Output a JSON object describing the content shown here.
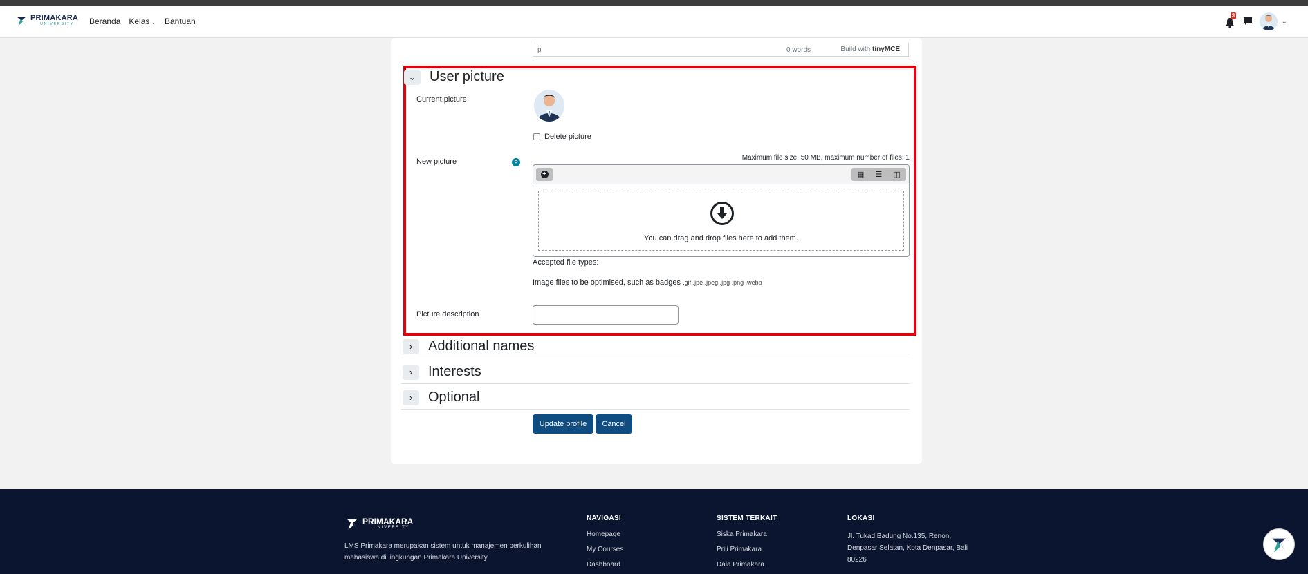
{
  "topbar": {
    "brand_name": "PRIMAKARA",
    "brand_sub": "UNIVERSITY",
    "nav": [
      "Beranda",
      "Kelas",
      "Bantuan"
    ],
    "notification_count": "3"
  },
  "editor_status": {
    "path": "p",
    "words": "0 words",
    "build_prefix": "Build with",
    "build_brand": "tinyMCE"
  },
  "user_picture": {
    "title": "User picture",
    "current_label": "Current picture",
    "delete_label": "Delete picture",
    "new_label": "New picture",
    "max_size": "Maximum file size: 50 MB, maximum number of files: 1",
    "drop_text": "You can drag and drop files here to add them.",
    "accepted_label": "Accepted file types:",
    "types_desc": "Image files to be optimised, such as badges",
    "types_ext": ".gif .jpe .jpeg .jpg .png .webp",
    "description_label": "Picture description",
    "description_value": ""
  },
  "sections": [
    "Additional names",
    "Interests",
    "Optional"
  ],
  "buttons": {
    "update": "Update profile",
    "cancel": "Cancel"
  },
  "footer": {
    "brand_name": "PRIMAKARA",
    "brand_sub": "UNIVERSITY",
    "about": "LMS Primakara merupakan sistem untuk manajemen perkulihan mahasiswa di lingkungan Primakara University",
    "nav_head": "NAVIGASI",
    "nav_items": [
      "Homepage",
      "My Courses",
      "Dashboard"
    ],
    "sys_head": "SISTEM TERKAIT",
    "sys_items": [
      "Siska Primakara",
      "Prili Primakara",
      "Dala Primakara"
    ],
    "loc_head": "LOKASI",
    "loc_text": "Jl. Tukad Badung No.135, Renon, Denpasar Selatan, Kota Denpasar, Bali 80226"
  },
  "colors": {
    "primary_button": "#0f4c81",
    "highlight_border": "#e3000f",
    "footer_bg": "#0b1530",
    "help_icon": "#00829b"
  }
}
